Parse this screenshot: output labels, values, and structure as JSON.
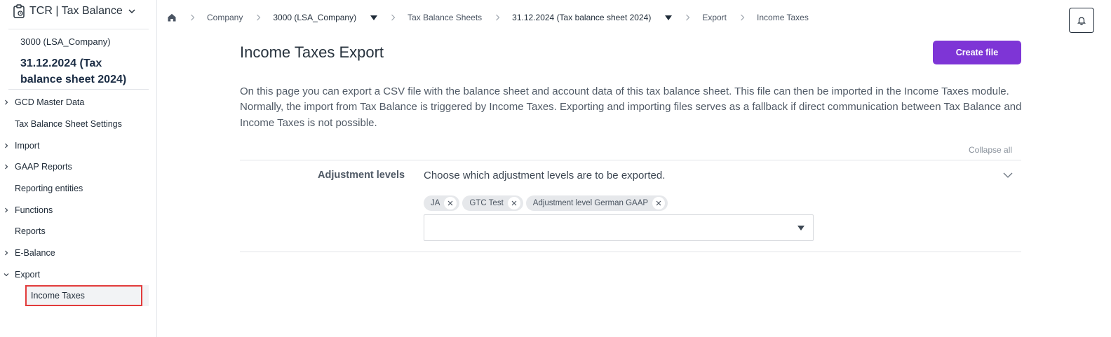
{
  "app": {
    "title": "TCR | Tax Balance"
  },
  "context": {
    "company": "3000 (LSA_Company)",
    "sheet": "31.12.2024 (Tax balance sheet 2024)"
  },
  "nav": {
    "items": [
      {
        "label": "GCD Master Data",
        "expandable": true
      },
      {
        "label": "Tax Balance Sheet Settings",
        "expandable": false
      },
      {
        "label": "Import",
        "expandable": true
      },
      {
        "label": "GAAP Reports",
        "expandable": true
      },
      {
        "label": "Reporting entities",
        "expandable": false
      },
      {
        "label": "Functions",
        "expandable": true
      },
      {
        "label": "Reports",
        "expandable": false
      },
      {
        "label": "E-Balance",
        "expandable": true
      },
      {
        "label": "Export",
        "expandable": true,
        "expanded": true
      }
    ],
    "export_sub": {
      "label": "Income Taxes",
      "selected": true
    }
  },
  "breadcrumb": {
    "company": "Company",
    "company_value": "3000 (LSA_Company)",
    "sheets": "Tax Balance Sheets",
    "sheet_value": "31.12.2024 (Tax balance sheet 2024)",
    "export": "Export",
    "current": "Income Taxes"
  },
  "page": {
    "title": "Income Taxes Export",
    "create_button": "Create file",
    "description": "On this page you can export a CSV file with the balance sheet and account data of this tax balance sheet. This file can then be imported in the Income Taxes module. Normally, the import from Tax Balance is triggered by Income Taxes. Exporting and importing files serves as a fallback if direct communication between Tax Balance and Income Taxes is not possible.",
    "collapse_all": "Collapse all"
  },
  "adjustment": {
    "label": "Adjustment levels",
    "hint": "Choose which adjustment levels are to be exported.",
    "tags": [
      "JA",
      "GTC Test",
      "Adjustment level German GAAP"
    ]
  },
  "colors": {
    "accent": "#7e35d6",
    "highlight": "#e23b3b",
    "text": "#1f2b38"
  },
  "icons": [
    "clipboard-icon",
    "chevron-down-icon",
    "home-icon",
    "chevron-right-icon",
    "caret-down-icon",
    "bell-icon",
    "close-icon"
  ]
}
